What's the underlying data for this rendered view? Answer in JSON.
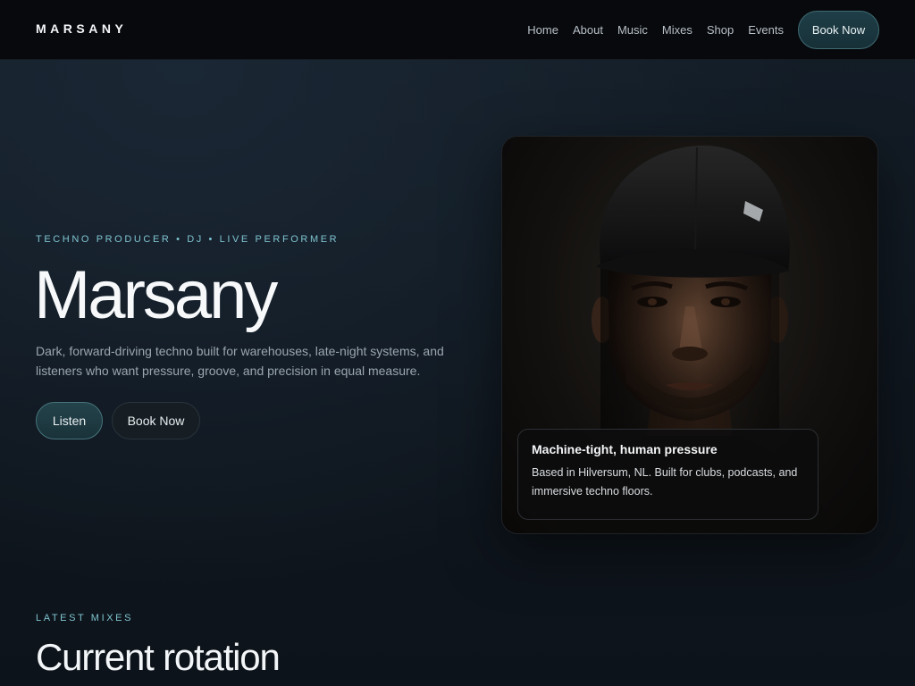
{
  "nav": {
    "brand": "MARSANY",
    "links": [
      "Home",
      "About",
      "Music",
      "Mixes",
      "Shop",
      "Events"
    ],
    "cta": "Book Now"
  },
  "hero": {
    "eyebrow": "TECHNO PRODUCER • DJ • LIVE PERFORMER",
    "title": "Marsany",
    "description": "Dark, forward-driving techno built for warehouses, late-night systems, and listeners who want pressure, groove, and precision in equal measure.",
    "listen_label": "Listen",
    "book_label": "Book Now"
  },
  "portrait": {
    "caption_title": "Machine-tight, human pressure",
    "caption_text": "Based in Hilversum, NL. Built for clubs, podcasts, and immersive techno floors."
  },
  "latest": {
    "eyebrow": "LATEST MIXES",
    "title": "Current rotation"
  },
  "colors": {
    "accent": "#7fc4d0",
    "button_teal": "#1f3e47",
    "background": "#0d141c"
  }
}
